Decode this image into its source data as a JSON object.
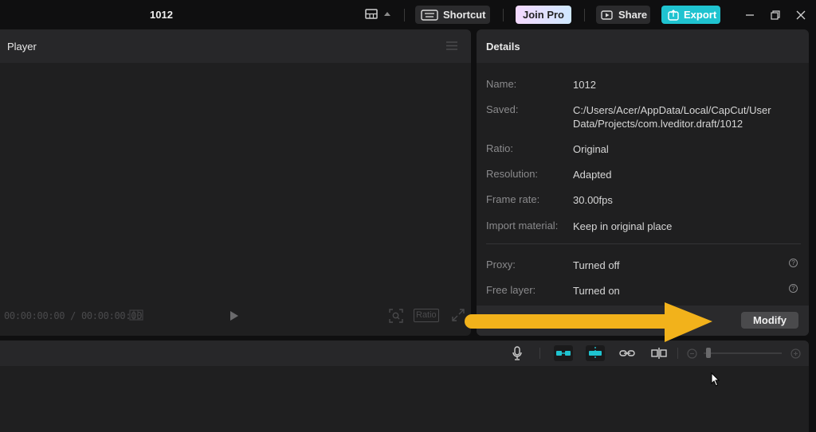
{
  "titlebar": {
    "project_name": "1012",
    "shortcut_label": "Shortcut",
    "join_pro_label": "Join Pro",
    "share_label": "Share",
    "export_label": "Export"
  },
  "player": {
    "title": "Player",
    "timecode": "00:00:00:00 / 00:00:00:00",
    "ratio_label": "Ratio"
  },
  "details": {
    "title": "Details",
    "rows": [
      {
        "label": "Name:",
        "value": "1012"
      },
      {
        "label": "Saved:",
        "value": "C:/Users/Acer/AppData/Local/CapCut/User Data/Projects/com.lveditor.draft/1012"
      },
      {
        "label": "Ratio:",
        "value": "Original"
      },
      {
        "label": "Resolution:",
        "value": "Adapted"
      },
      {
        "label": "Frame rate:",
        "value": "30.00fps"
      },
      {
        "label": "Import material:",
        "value": "Keep in original place"
      },
      {
        "label": "Proxy:",
        "value": "Turned off"
      },
      {
        "label": "Free layer:",
        "value": "Turned on"
      }
    ],
    "modify_label": "Modify"
  },
  "colors": {
    "accent": "#1fc3d0",
    "annotation_arrow": "#f2b21b"
  },
  "icons": [
    "layout-icon",
    "keyboard-icon",
    "share-icon",
    "export-icon",
    "minimize-icon",
    "restore-icon",
    "close-icon",
    "menu-icon",
    "play-icon",
    "zoom-fit-icon",
    "fullscreen-icon",
    "microphone-icon",
    "link-clips-icon",
    "snap-icon",
    "link-icon",
    "split-icon",
    "zoom-out-icon",
    "zoom-in-icon",
    "arrow-annotation",
    "mouse-cursor"
  ]
}
